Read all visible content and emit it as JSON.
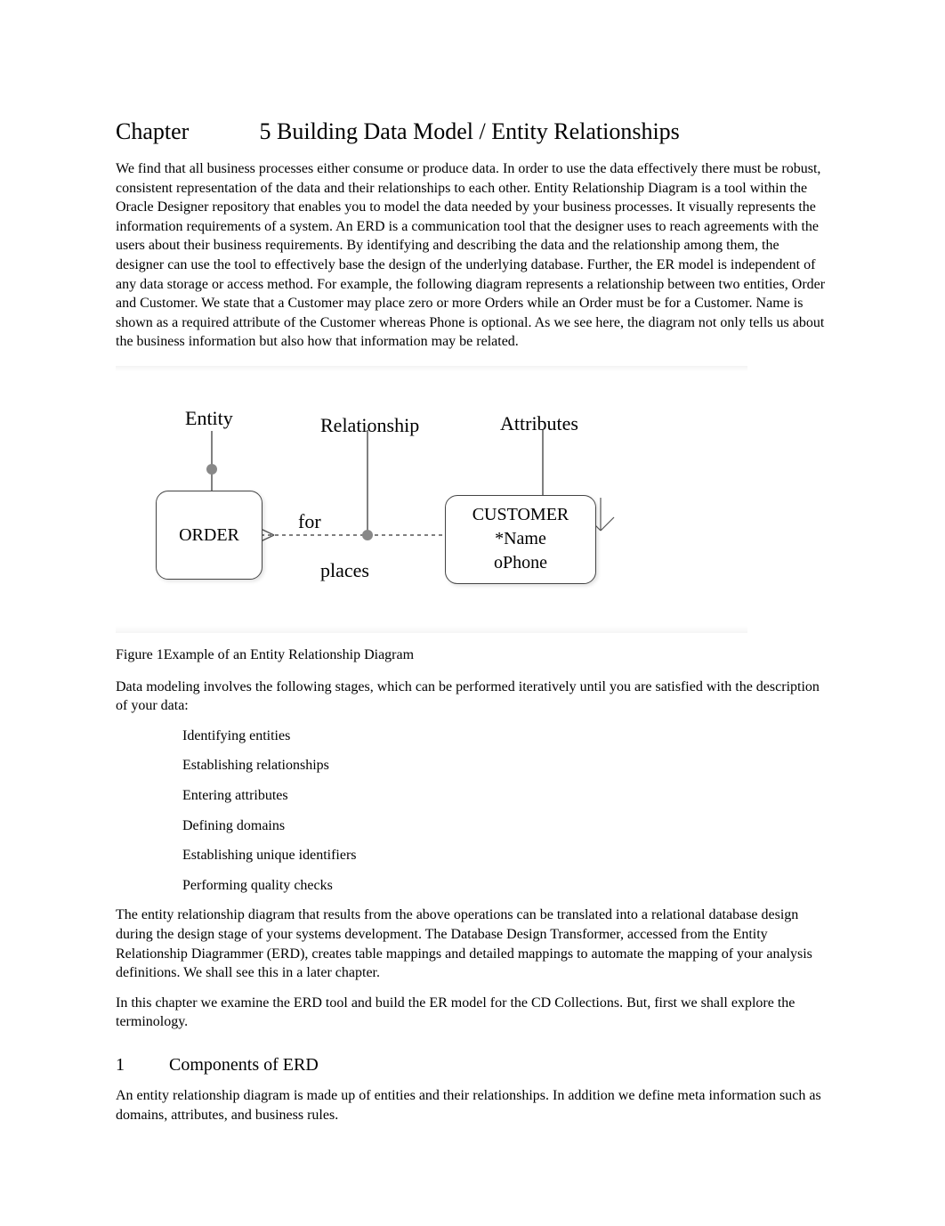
{
  "heading": {
    "chapterLabel": "Chapter",
    "title": "5 Building Data Model / Entity Relationships"
  },
  "intro": "We find that all business processes either consume or produce data. In order to use the data effectively there must be robust, consistent representation of the data and their relationships to each other. Entity Relationship Diagram is a tool within the Oracle Designer repository that enables you to model the data needed by your business processes. It visually represents the information requirements of a system. An ERD is a communication tool that the designer uses to reach agreements with the users about their business requirements. By identifying and describing the data and the relationship among them, the designer can use the tool to effectively base the design of the underlying database. Further, the ER model is independent of any data storage or access method. For example, the following diagram represents a relationship between two entities, Order and Customer. We state that a Customer may place zero or more Orders while an Order must be for a Customer. Name is shown as a required attribute of the Customer whereas Phone is optional. As we see here, the diagram not only tells us about the business information but also how that information may be related.",
  "diagram": {
    "labelEntity": "Entity",
    "labelRelationship": "Relationship",
    "labelAttributes": "Attributes",
    "forLabel": "for",
    "placesLabel": "places",
    "order": {
      "name": "ORDER"
    },
    "customer": {
      "name": "CUSTOMER",
      "attr1": "*Name",
      "attr2": "oPhone"
    }
  },
  "figureCaption": "Figure 1Example of an Entity Relationship Diagram",
  "stagesIntro": "Data modeling  involves the following stages, which can be performed iteratively until you are satisfied with the description of your data:",
  "stages": {
    "s1": "Identifying entities",
    "s2": "Establishing relationships",
    "s3": "Entering attributes",
    "s4": "Defining domains",
    "s5": "Establishing unique identifiers",
    "s6": "Performing quality checks"
  },
  "afterList1": "The entity relationship diagram that results from the above operations can be translated into a relational database design during the design stage of your systems development. The Database Design Transformer, accessed from the Entity Relationship Diagrammer (ERD), creates table mappings and detailed mappings to automate the mapping of your analysis definitions. We shall see this in a later chapter.",
  "afterList2": "In this chapter we examine the ERD tool and build the ER model for the CD Collections. But, first we shall explore the terminology.",
  "section1": {
    "num": "1",
    "title": "Components of ERD",
    "body": "An entity relationship diagram is made up of entities and their relationships. In addition we define meta information such as domains, attributes, and business rules."
  }
}
